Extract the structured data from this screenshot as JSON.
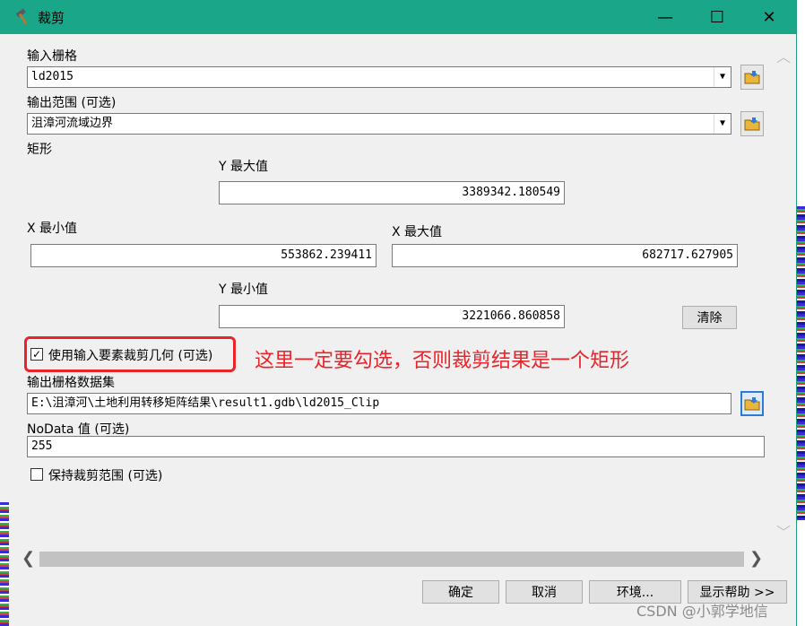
{
  "window": {
    "title": "裁剪",
    "title_icon": "hammer-icon",
    "controls": {
      "minimize": "—",
      "maximize": "☐",
      "close": "✕"
    },
    "accent_color": "#19a689"
  },
  "form": {
    "input_raster": {
      "label": "输入栅格",
      "value": "ld2015"
    },
    "output_extent": {
      "label": "输出范围 (可选)",
      "value": "沮漳河流域边界"
    },
    "rectangle": {
      "label": "矩形",
      "y_max_label": "Y 最大值",
      "y_max": "3389342.180549",
      "x_min_label": "X 最小值",
      "x_min": "553862.239411",
      "x_max_label": "X 最大值",
      "x_max": "682717.627905",
      "y_min_label": "Y 最小值",
      "y_min": "3221066.860858",
      "clear_label": "清除"
    },
    "use_geometry": {
      "label": "使用输入要素裁剪几何 (可选)",
      "checked": true
    },
    "annotation": "这里一定要勾选，否则裁剪结果是一个矩形",
    "output_raster": {
      "label": "输出栅格数据集",
      "value": "E:\\沮漳河\\土地利用转移矩阵结果\\result1.gdb\\ld2015_Clip"
    },
    "nodata": {
      "label": "NoData 值 (可选)",
      "value": "255"
    },
    "maintain_extent": {
      "label": "保持裁剪范围 (可选)",
      "checked": false
    }
  },
  "buttons": {
    "ok": "确定",
    "cancel": "取消",
    "env": "环境...",
    "help": "显示帮助 >>"
  },
  "watermark": "CSDN @小郭学地信"
}
